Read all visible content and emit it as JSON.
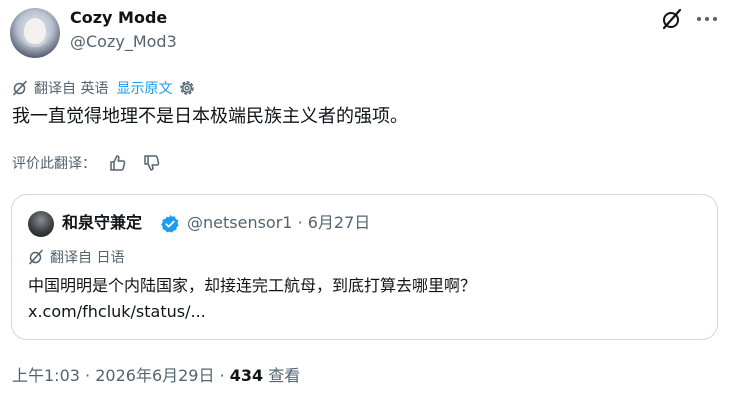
{
  "author": {
    "display_name": "Cozy Mode",
    "handle": "@Cozy_Mod3"
  },
  "icons": {
    "grok": "grok-icon",
    "more": "more-icon",
    "translate": "translate-icon",
    "gear": "gear-icon",
    "thumbs_up": "thumbs-up-icon",
    "thumbs_down": "thumbs-down-icon",
    "verified": "verified-badge-icon"
  },
  "translation": {
    "label": "翻译自 英语",
    "show_original": "显示原文"
  },
  "tweet": {
    "text": "我一直觉得地理不是日本极端民族主义者的强项。"
  },
  "rating": {
    "label": "评价此翻译："
  },
  "quote": {
    "display_name": "和泉守兼定",
    "handle": "@netsensor1",
    "separator": "·",
    "date": "6月27日",
    "translation_label": "翻译自 日语",
    "text": "中国明明是个内陆国家，却接连完工航母，到底打算去哪里啊？",
    "link": "x.com/fhcluk/status/..."
  },
  "footer": {
    "time": "上午1:03",
    "separator": "·",
    "date": "2026年6月29日",
    "views_count": "434",
    "views_label": "查看"
  },
  "colors": {
    "text": "#0f1419",
    "secondary": "#536471",
    "accent": "#1d9bf0",
    "border": "#cfd9de"
  }
}
